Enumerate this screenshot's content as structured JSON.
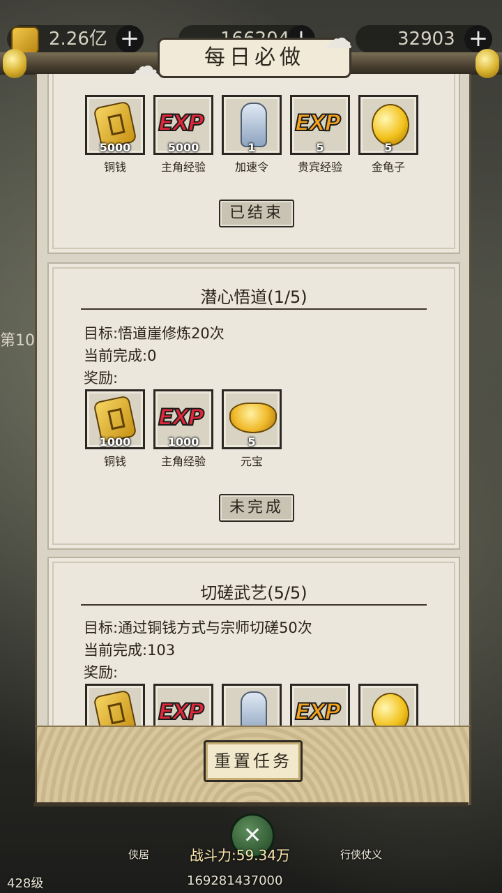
{
  "top": {
    "res1": "2.26亿",
    "res2": "166204",
    "res3": "32903"
  },
  "window_title": "每日必做",
  "cards": [
    {
      "items": [
        {
          "name": "铜钱",
          "qty": "5000",
          "icon": "coin-icon"
        },
        {
          "name": "主角经验",
          "qty": "5000",
          "icon": "exp-red-icon"
        },
        {
          "name": "加速令",
          "qty": "1",
          "icon": "token-icon"
        },
        {
          "name": "贵宾经验",
          "qty": "5",
          "icon": "exp-gold-icon"
        },
        {
          "name": "金龟子",
          "qty": "5",
          "icon": "golden-beetle-icon"
        }
      ],
      "button": "已结束"
    },
    {
      "title": "潜心悟道(1/5)",
      "target": "目标:悟道崖修炼20次",
      "progress": "当前完成:0",
      "reward_label": "奖励:",
      "items": [
        {
          "name": "铜钱",
          "qty": "1000",
          "icon": "coin-icon"
        },
        {
          "name": "主角经验",
          "qty": "1000",
          "icon": "exp-red-icon"
        },
        {
          "name": "元宝",
          "qty": "5",
          "icon": "ingot-icon"
        }
      ],
      "button": "未完成"
    },
    {
      "title": "切磋武艺(5/5)",
      "target": "目标:通过铜钱方式与宗师切磋50次",
      "progress": "当前完成:103",
      "reward_label": "奖励:"
    }
  ],
  "exp_text": "EXP",
  "reset_button": "重置任务",
  "hud": {
    "home_label": "侠居",
    "right_label": "行侠仗义",
    "power": "战斗力:59.34万",
    "score": "169281437000",
    "level": "428级",
    "side_text": "第10"
  },
  "colors": {
    "exp_red": "#e0283a",
    "exp_gold": "#f5a21c",
    "paper": "#ebe7dd"
  }
}
